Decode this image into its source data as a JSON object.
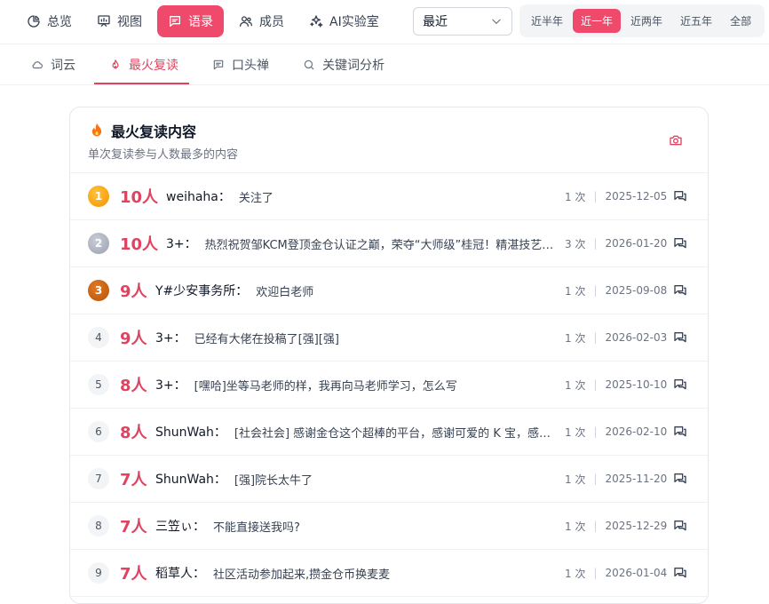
{
  "nav": {
    "items": [
      {
        "label": "总览",
        "icon": "pie-chart-icon"
      },
      {
        "label": "视图",
        "icon": "presentation-icon"
      },
      {
        "label": "语录",
        "icon": "quote-bubble-icon",
        "active": true
      },
      {
        "label": "成员",
        "icon": "users-icon"
      },
      {
        "label": "AI实验室",
        "icon": "sparkles-icon"
      }
    ],
    "select_value": "最近",
    "ranges": [
      {
        "label": "近半年"
      },
      {
        "label": "近一年",
        "active": true
      },
      {
        "label": "近两年"
      },
      {
        "label": "近五年"
      },
      {
        "label": "全部"
      }
    ]
  },
  "subnav": {
    "items": [
      {
        "label": "词云",
        "icon": "cloud-icon"
      },
      {
        "label": "最火复读",
        "icon": "flame-icon",
        "active": true
      },
      {
        "label": "口头禅",
        "icon": "chat-icon"
      },
      {
        "label": "关键词分析",
        "icon": "search-icon"
      }
    ]
  },
  "card": {
    "title": "最火复读内容",
    "subtitle": "单次复读参与人数最多的内容"
  },
  "rows": [
    {
      "rank": "1",
      "count": "10人",
      "speaker": "weihaha：",
      "message": "关注了",
      "times": "1 次",
      "date": "2025-12-05"
    },
    {
      "rank": "2",
      "count": "10人",
      "speaker": "3+：",
      "message": "热烈祝贺邹KCM登顶金仓认证之巅，荣夺“大师级”桂冠！精湛技艺与不懈追求，成就今日辉煌",
      "times": "3 次",
      "date": "2026-01-20"
    },
    {
      "rank": "3",
      "count": "9人",
      "speaker": "Y#少安事务所：",
      "message": "欢迎白老师",
      "times": "1 次",
      "date": "2025-09-08"
    },
    {
      "rank": "4",
      "count": "9人",
      "speaker": "3+：",
      "message": "已经有大佬在投稿了[强][强]",
      "times": "1 次",
      "date": "2026-02-03"
    },
    {
      "rank": "5",
      "count": "8人",
      "speaker": "3+：",
      "message": "[嘿哈]坐等马老师的样，我再向马老师学习，怎么写",
      "times": "1 次",
      "date": "2025-10-10"
    },
    {
      "rank": "6",
      "count": "8人",
      "speaker": "ShunWah：",
      "message": "[社会社会] 感谢金仓这个超棒的平台，感谢可爱的 K 宝，感谢每一位小伙伴",
      "times": "1 次",
      "date": "2026-02-10"
    },
    {
      "rank": "7",
      "count": "7人",
      "speaker": "ShunWah：",
      "message": "[强]院长太牛了",
      "times": "1 次",
      "date": "2025-11-20"
    },
    {
      "rank": "8",
      "count": "7人",
      "speaker": "三笠ぃ：",
      "message": "不能直接送我吗?",
      "times": "1 次",
      "date": "2025-12-29"
    },
    {
      "rank": "9",
      "count": "7人",
      "speaker": "稻草人：",
      "message": "社区活动参加起来,攒金仓币换麦麦",
      "times": "1 次",
      "date": "2026-01-04"
    }
  ],
  "colors": {
    "accent": "#ef4a6c",
    "accent_text": "#e0425f"
  }
}
